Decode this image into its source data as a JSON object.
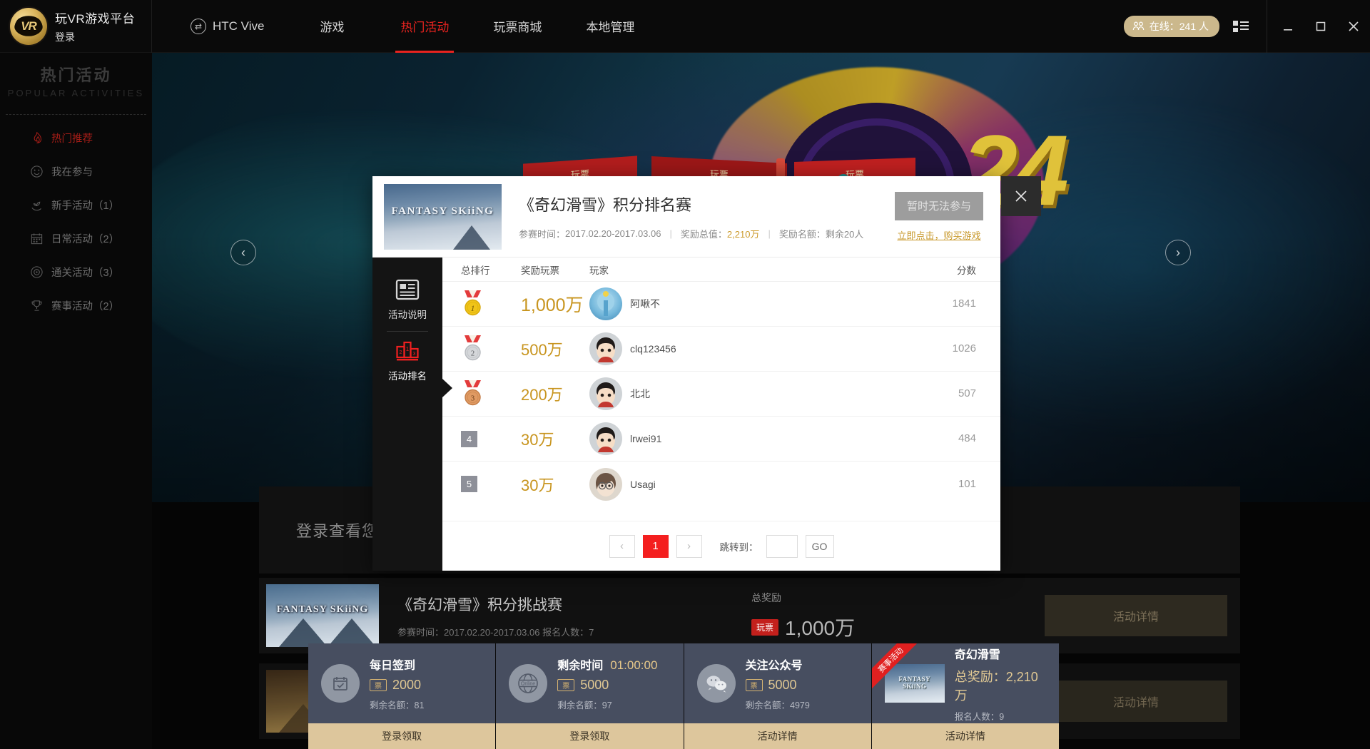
{
  "topbar": {
    "brand_title": "玩VR游戏平台",
    "brand_login": "登录",
    "nav": [
      {
        "label": "HTC Vive",
        "icon": "vive-icon",
        "active": false
      },
      {
        "label": "游戏",
        "icon": "",
        "active": false
      },
      {
        "label": "热门活动",
        "icon": "",
        "active": true
      },
      {
        "label": "玩票商城",
        "icon": "",
        "active": false
      },
      {
        "label": "本地管理",
        "icon": "",
        "active": false
      }
    ],
    "online_label": "在线：241 人",
    "online_icon": "users-icon",
    "grid_icon": "list-view-icon",
    "minimize_icon": "minimize-icon",
    "maximize_icon": "maximize-icon",
    "close_icon": "close-icon",
    "accent_red": "#e8231f",
    "pill_color": "#cbb88c"
  },
  "sidebar": {
    "heading_cn": "热门活动",
    "heading_en": "POPULAR ACTIVITIES",
    "items": [
      {
        "label": "热门推荐",
        "icon": "fire-icon",
        "active": true
      },
      {
        "label": "我在参与",
        "icon": "smiley-refresh-icon",
        "active": false
      },
      {
        "label": "新手活动（1）",
        "icon": "sprout-hand-icon",
        "active": false
      },
      {
        "label": "日常活动（2）",
        "icon": "calendar-icon",
        "active": false
      },
      {
        "label": "通关活动（3）",
        "icon": "target-icon",
        "active": false
      },
      {
        "label": "赛事活动（2）",
        "icon": "trophy-icon",
        "active": false
      }
    ]
  },
  "banner": {
    "prev_arrow": "‹",
    "next_arrow": "›",
    "number": "24",
    "ribbons": [
      "玩票",
      "玩票",
      "玩票"
    ]
  },
  "loginbox": {
    "text": "登录查看您的活动"
  },
  "activity_row": {
    "thumb_text": "FANTASY SKiiNG",
    "title": "《奇幻滑雪》积分挑战赛",
    "meta": "参赛时间：2017.02.20-2017.03.06  报名人数：7",
    "prize_label": "总奖励",
    "prize_chip": "玩票",
    "prize_value": "1,000万",
    "detail_button": "活动详情"
  },
  "taskbar": {
    "next_arrow": "›",
    "cards": [
      {
        "icon": "calendar-check-icon",
        "name": "每日签到",
        "time": "",
        "ticket_badge": "票",
        "reward": "2000",
        "sub": "剩余名额：81",
        "footer": "登录领取",
        "ribbon": "",
        "thumb_text": ""
      },
      {
        "icon": "globe-online-icon",
        "name": "剩余时间",
        "time": "01:00:00",
        "ticket_badge": "票",
        "reward": "5000",
        "sub": "剩余名额：97",
        "footer": "登录领取",
        "ribbon": "",
        "thumb_text": ""
      },
      {
        "icon": "wechat-icon",
        "name": "关注公众号",
        "time": "",
        "ticket_badge": "票",
        "reward": "5000",
        "sub": "剩余名额：4979",
        "footer": "活动详情",
        "ribbon": "",
        "thumb_text": ""
      },
      {
        "icon": "",
        "name": "奇幻滑雪",
        "time": "",
        "ticket_badge": "",
        "reward": "总奖励：2,210万",
        "sub": "报名人数：9",
        "footer": "活动详情",
        "ribbon": "赛事活动",
        "thumb_text": "FANTASY SKiiNG"
      }
    ]
  },
  "modal": {
    "close_icon": "close-icon",
    "thumb_text": "FANTASY SKiiNG",
    "title": "《奇幻滑雪》积分排名赛",
    "meta": {
      "time_label": "参赛时间：",
      "time_value": "2017.02.20-2017.03.06",
      "prize_label": "奖励总值：",
      "prize_value": "2,210万",
      "quota_label": "奖励名额：",
      "quota_value": "剩余20人",
      "sep": "|"
    },
    "join_button": "暂时无法参与",
    "buy_link": "立即点击，购买游戏",
    "tabs": [
      {
        "label": "活动说明",
        "icon": "article-icon",
        "active": false
      },
      {
        "label": "活动排名",
        "icon": "podium-icon",
        "active": true
      }
    ],
    "table": {
      "headers": {
        "rank": "总排行",
        "ticket": "奖励玩票",
        "player": "玩家",
        "score": "分数"
      },
      "rows": [
        {
          "rank": "1",
          "medal": "gold",
          "ticket": "1,000万",
          "player": "阿啾不",
          "avatar": "avatar-blue-bird",
          "score": "1841"
        },
        {
          "rank": "2",
          "medal": "silver",
          "ticket": "500万",
          "player": "clq123456",
          "avatar": "avatar-dark-hair",
          "score": "1026"
        },
        {
          "rank": "3",
          "medal": "bronze",
          "ticket": "200万",
          "player": "北北",
          "avatar": "avatar-dark-hair",
          "score": "507"
        },
        {
          "rank": "4",
          "medal": "",
          "ticket": "30万",
          "player": "lrwei91",
          "avatar": "avatar-dark-hair",
          "score": "484"
        },
        {
          "rank": "5",
          "medal": "",
          "ticket": "30万",
          "player": "Usagi",
          "avatar": "avatar-glasses",
          "score": "101"
        }
      ]
    },
    "pager": {
      "prev": "‹",
      "pages": [
        "1"
      ],
      "current": "1",
      "next": "›",
      "jump_label": "跳转到：",
      "jump_value": "",
      "jump_placeholder": "",
      "go": "GO"
    }
  }
}
